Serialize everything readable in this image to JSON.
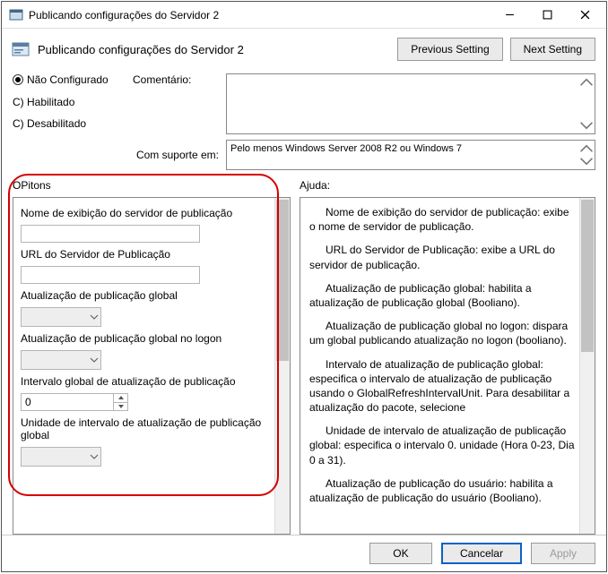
{
  "window": {
    "title": "Publicando configurações do Servidor 2",
    "subtitle": "Publicando configurações do Servidor 2"
  },
  "nav": {
    "prev": "Previous Setting",
    "next": "Next Setting"
  },
  "state_radios": {
    "not_configured": "Não Configurado",
    "enabled": "C) Habilitado",
    "disabled": "C) Desabilitado"
  },
  "labels": {
    "comment": "Comentário:",
    "supported": "Com suporte em:",
    "options_panel": "OPitons",
    "help_panel": "Ajuda:"
  },
  "supported_text": "Pelo menos Windows Server 2008 R2 ou Windows 7",
  "options": {
    "display_name_label": "Nome de exibição do servidor de publicação",
    "display_name_value": "",
    "url_label": "URL do Servidor de Publicação",
    "url_value": "",
    "global_refresh_label": "Atualização de publicação global",
    "global_refresh_value": "",
    "global_refresh_logon_label": "Atualização de publicação global no logon",
    "global_refresh_logon_value": "",
    "global_interval_label": "Intervalo global de atualização de publicação",
    "global_interval_value": "0",
    "global_interval_unit_label": "Unidade de intervalo de atualização de publicação global",
    "global_interval_unit_value": ""
  },
  "help": {
    "p1a": "Nome de exibição do servidor de publicação: exibe o nome de servidor de publicação.",
    "p2": "URL do Servidor de Publicação: exibe a URL do servidor de publicação.",
    "p3": "Atualização de publicação global: habilita a atualização de publicação global (Booliano).",
    "p4": "Atualização de publicação global no logon: dispara um global publicando atualização no logon (booliano).",
    "p5": "Intervalo de atualização de publicação global: especifica o intervalo de atualização de publicação usando o GlobalRefreshIntervalUnit. Para desabilitar a atualização do pacote, selecione",
    "p6": "Unidade de intervalo de atualização de publicação global: especifica o intervalo 0. unidade (Hora 0-23, Dia 0 a 31).",
    "p7": "Atualização de publicação do usuário: habilita a atualização de publicação do usuário (Booliano)."
  },
  "footer": {
    "ok": "OK",
    "cancel": "Cancelar",
    "apply": "Apply"
  }
}
